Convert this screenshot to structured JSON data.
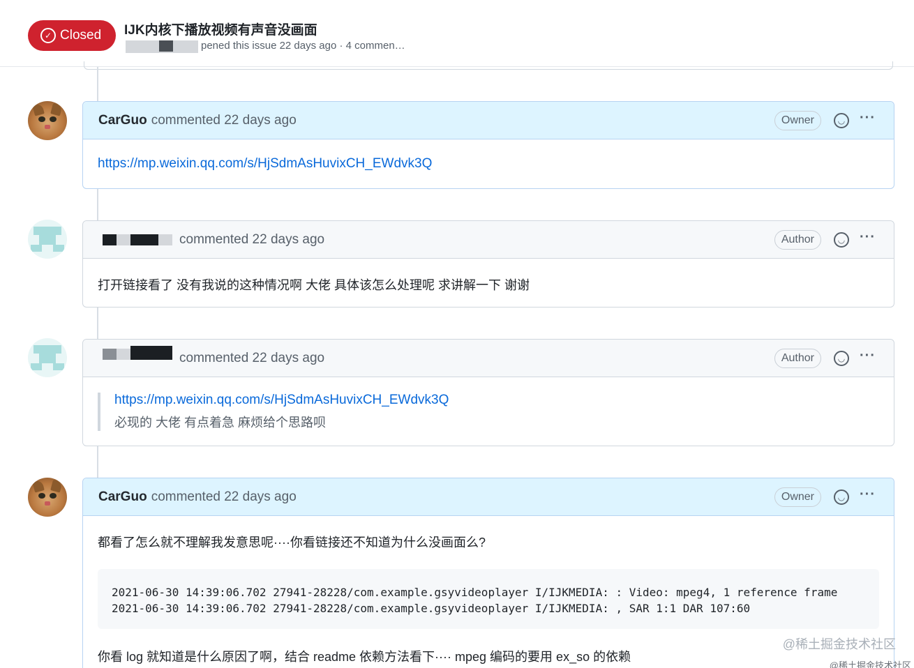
{
  "issue": {
    "state": "Closed",
    "title": "IJK内核下播放视频有声音没画面",
    "meta": "pened this issue 22 days ago · 4 commen…"
  },
  "comments": [
    {
      "author": "CarGuo",
      "action": "commented 22 days ago",
      "role": "Owner",
      "link": "https://mp.weixin.qq.com/s/HjSdmAsHuvixCH_EWdvk3Q"
    },
    {
      "action": "commented 22 days ago",
      "role": "Author",
      "text": "打开链接看了 没有我说的这种情况啊 大佬 具体该怎么处理呢 求讲解一下 谢谢"
    },
    {
      "action": "commented 22 days ago",
      "role": "Author",
      "quote_link": "https://mp.weixin.qq.com/s/HjSdmAsHuvixCH_EWdvk3Q",
      "quote_text": "必现的 大佬 有点着急 麻烦给个思路呗"
    },
    {
      "author": "CarGuo",
      "action": "commented 22 days ago",
      "role": "Owner",
      "text": "都看了怎么就不理解我发意思呢····你看链接还不知道为什么没画面么?",
      "code": [
        "2021-06-30 14:39:06.702 27941-28228/com.example.gsyvideoplayer I/IJKMEDIA: : Video: mpeg4, 1 reference frame",
        "2021-06-30 14:39:06.702 27941-28228/com.example.gsyvideoplayer I/IJKMEDIA: , SAR 1:1 DAR 107:60"
      ],
      "text2": "你看 log 就知道是什么原因了啊，结合 readme 依赖方法看下···· mpeg 编码的要用 ex_so 的依赖"
    }
  ],
  "watermark": "@稀土掘金技术社区",
  "watermark_small": "@稀土掘金技术社区",
  "icons": {
    "state": "circle-check-icon",
    "reaction": "smiley-icon",
    "menu": "kebab-horizontal-icon"
  },
  "colors": {
    "closed": "#cf222e",
    "link": "#0969da",
    "owner_header": "#ddf4ff"
  }
}
